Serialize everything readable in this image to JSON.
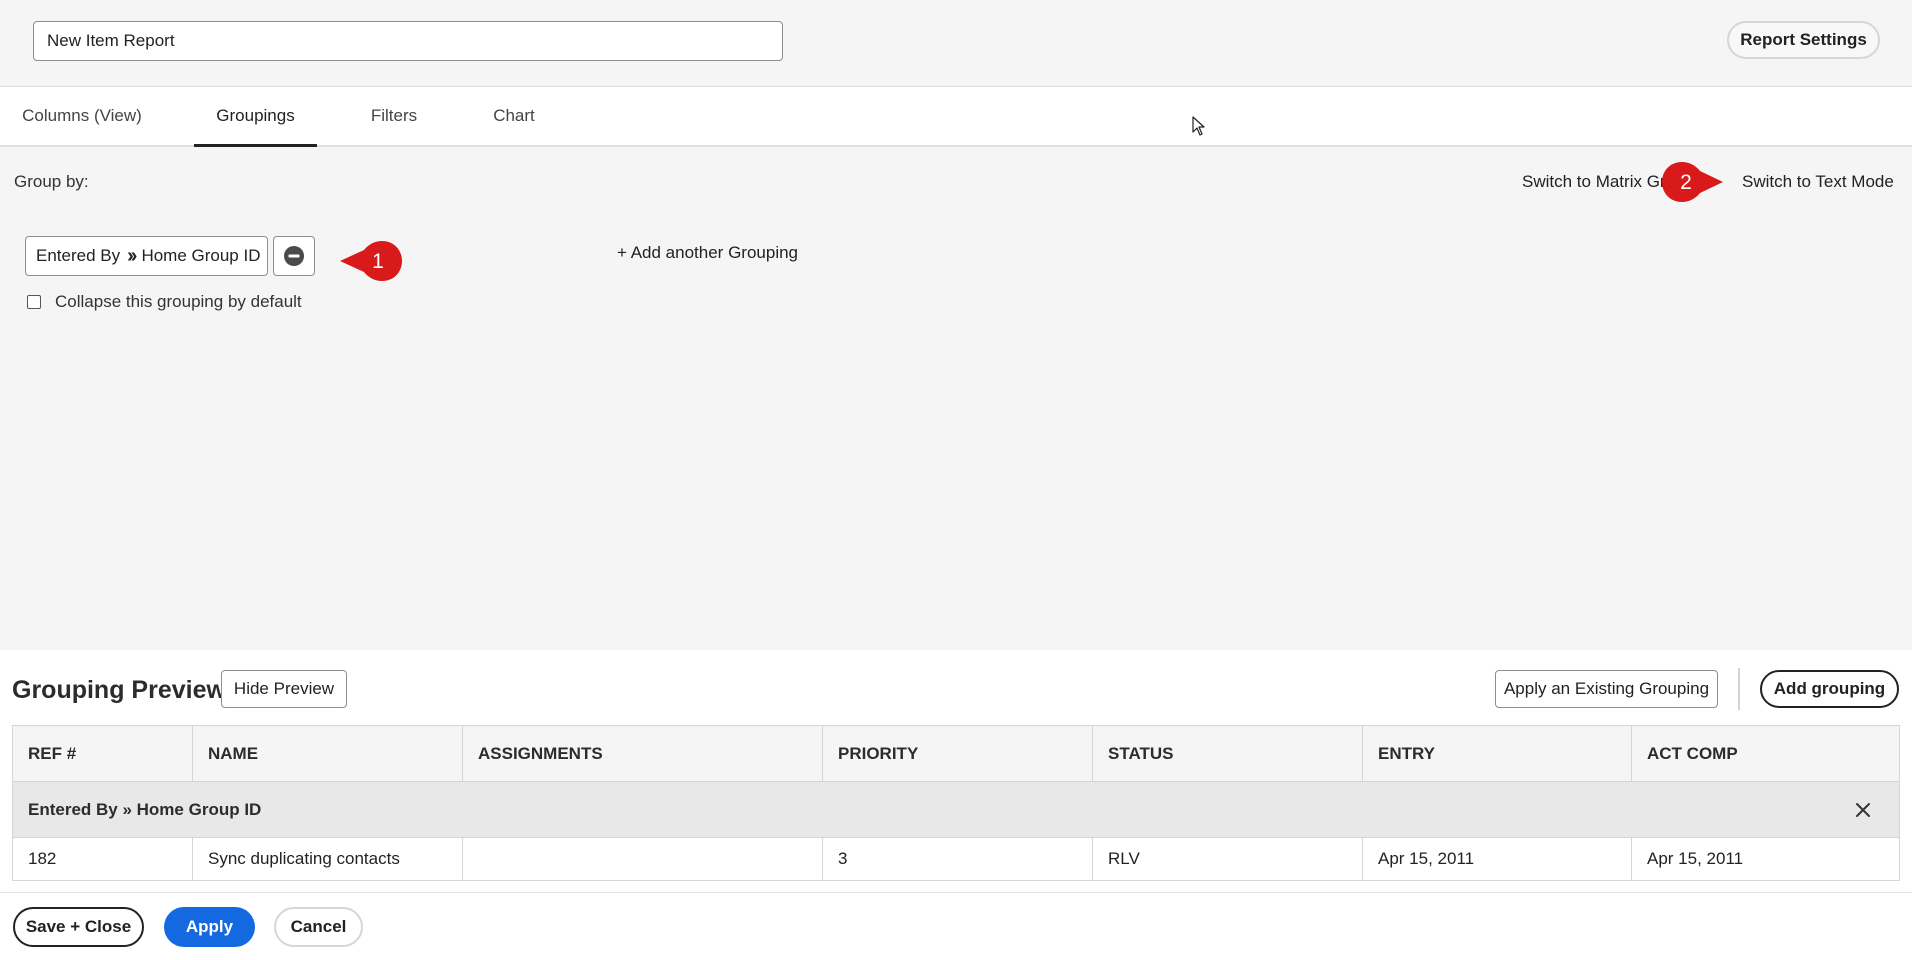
{
  "header": {
    "report_name": "New Item Report",
    "settings_label": "Report Settings"
  },
  "tabs": [
    {
      "label": "Columns (View)",
      "active": false
    },
    {
      "label": "Groupings",
      "active": true
    },
    {
      "label": "Filters",
      "active": false
    },
    {
      "label": "Chart",
      "active": false
    }
  ],
  "groupings": {
    "group_by_label": "Group by:",
    "switch_matrix_label": "Switch to Matrix Grouping",
    "switch_text_label": "Switch to Text Mode",
    "chip": {
      "field": "Entered By",
      "subfield": "Home Group ID"
    },
    "add_another_label": "+ Add another Grouping",
    "collapse_label": "Collapse this grouping by default",
    "collapse_checked": false
  },
  "callouts": [
    {
      "number": "1",
      "color": "#d91a1a"
    },
    {
      "number": "2",
      "color": "#d91a1a"
    }
  ],
  "preview": {
    "title": "Grouping Preview",
    "hide_label": "Hide Preview",
    "apply_existing_label": "Apply an Existing Grouping",
    "add_grouping_label": "Add grouping",
    "columns": [
      "REF #",
      "NAME",
      "ASSIGNMENTS",
      "PRIORITY",
      "STATUS",
      "ENTRY",
      "ACT COMP"
    ],
    "group_header": "Entered By » Home Group ID",
    "rows": [
      {
        "ref": "182",
        "name": "Sync duplicating contacts",
        "assignments": "",
        "priority": "3",
        "status": "RLV",
        "entry": "Apr 15, 2011",
        "act_comp": "Apr 15, 2011"
      }
    ]
  },
  "footer": {
    "save_close_label": "Save + Close",
    "apply_label": "Apply",
    "cancel_label": "Cancel"
  },
  "colors": {
    "accent_blue": "#1468e0",
    "callout_red": "#d91a1a"
  }
}
